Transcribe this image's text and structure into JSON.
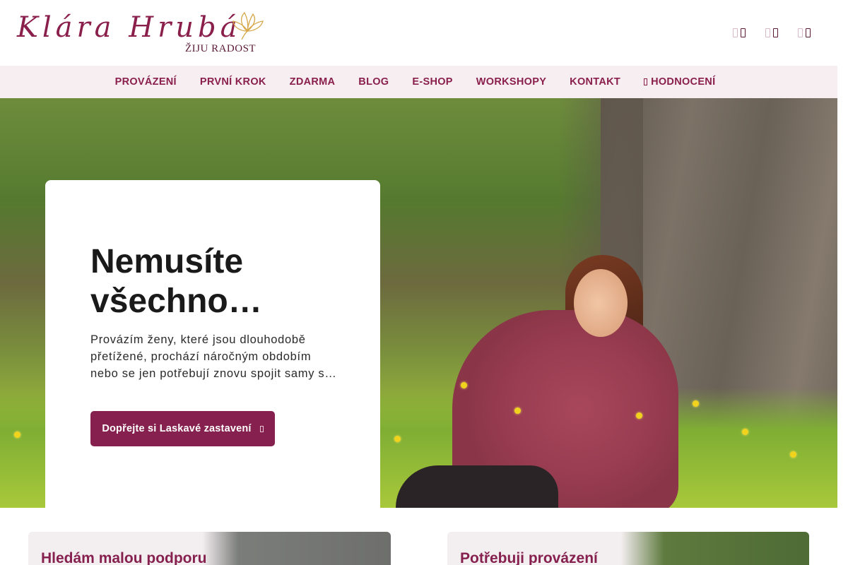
{
  "header": {
    "logo_name": "Klára Hrubá",
    "logo_tagline": "ŽIJU RADOST",
    "icons": [
      {
        "name": "facebook-icon",
        "glyph": "f"
      },
      {
        "name": "instagram-icon",
        "glyph": "◎"
      },
      {
        "name": "email-icon",
        "glyph": "✉"
      }
    ]
  },
  "nav": {
    "items": [
      {
        "label": "PROVÁZENÍ"
      },
      {
        "label": "PRVNÍ KROK"
      },
      {
        "label": "ZDARMA"
      },
      {
        "label": "BLOG"
      },
      {
        "label": "E-SHOP"
      },
      {
        "label": "WORKSHOPY"
      },
      {
        "label": "KONTAKT"
      },
      {
        "label": "HODNOCENÍ",
        "icon": "star-icon"
      }
    ]
  },
  "hero": {
    "title": "Nemusíte všechno…",
    "text": "Provázím ženy, které jsou dlouhodobě přetížené, prochází náročným obdobím nebo se jen potřebují znovu spojit samy s…",
    "button_label": "Dopřejte si Laskavé zastavení"
  },
  "cards": [
    {
      "title": "Hledám malou podporu"
    },
    {
      "title": "Potřebuji provázení"
    }
  ],
  "colors": {
    "brand": "#86214f",
    "nav_bg": "#f7eef2"
  }
}
